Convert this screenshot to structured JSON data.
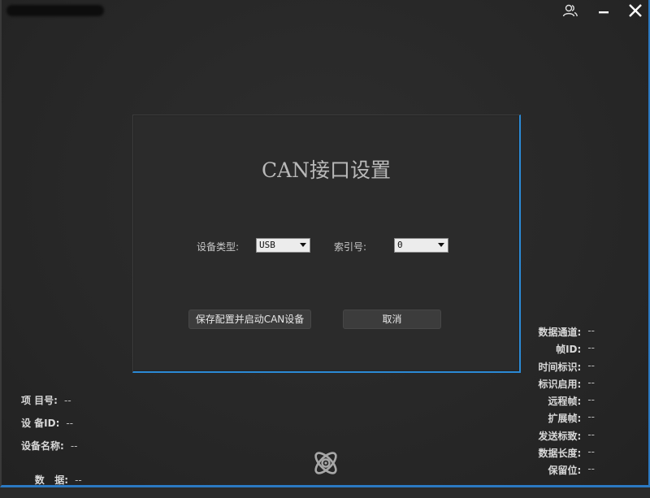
{
  "window": {
    "user_icon": "users-icon",
    "minimize_icon": "minimize-icon",
    "close_icon": "close-icon"
  },
  "dialog": {
    "title": "CAN接口设置",
    "device_type_label": "设备类型:",
    "device_type_value": "USB",
    "index_label": "索引号:",
    "index_value": "0",
    "save_button": "保存配置并启动CAN设备",
    "cancel_button": "取消"
  },
  "left_info": [
    {
      "label": "项 目号:",
      "value": "--"
    },
    {
      "label": "设 备ID:",
      "value": "--"
    },
    {
      "label": "设备名称:",
      "value": "--"
    },
    {
      "label": "数   据:",
      "value": "--"
    }
  ],
  "right_info": [
    {
      "label": "数据通道:",
      "value": "--"
    },
    {
      "label": "帧ID:",
      "value": "--"
    },
    {
      "label": "时间标识:",
      "value": "--"
    },
    {
      "label": "标识启用:",
      "value": "--"
    },
    {
      "label": "远程帧:",
      "value": "--"
    },
    {
      "label": "扩展帧:",
      "value": "--"
    },
    {
      "label": "发送标致:",
      "value": "--"
    },
    {
      "label": "数据长度:",
      "value": "--"
    },
    {
      "label": "保留位:",
      "value": "--"
    }
  ],
  "colors": {
    "accent": "#2b79c2",
    "background": "#2a2a2a",
    "dialog_border": "#2b8ad6"
  },
  "logo_icon": "atom-logo-icon"
}
